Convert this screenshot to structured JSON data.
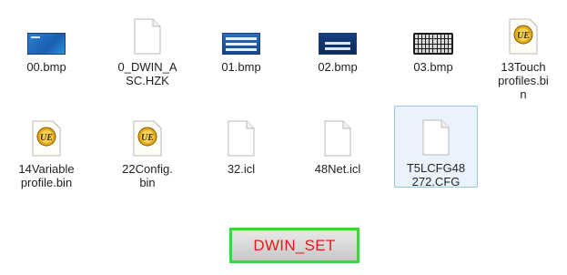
{
  "files": [
    {
      "name": "00.bmp",
      "lines": [
        "00.bmp"
      ],
      "type": "bmp-blue-login"
    },
    {
      "name": "0_DWIN_ASC.HZK",
      "lines": [
        "0_DWIN_A",
        "SC.HZK"
      ],
      "type": "blank-document"
    },
    {
      "name": "01.bmp",
      "lines": [
        "01.bmp"
      ],
      "type": "bmp-blue-form"
    },
    {
      "name": "02.bmp",
      "lines": [
        "02.bmp"
      ],
      "type": "bmp-dark-blue"
    },
    {
      "name": "03.bmp",
      "lines": [
        "03.bmp"
      ],
      "type": "bmp-keyboard"
    },
    {
      "name": "13Touch profiles.bin",
      "lines": [
        "13Touch",
        "profiles.bi",
        "n"
      ],
      "type": "ultraedit"
    },
    {
      "name": "14Variable profile.bin",
      "lines": [
        "14Variable",
        "profile.bin"
      ],
      "type": "ultraedit"
    },
    {
      "name": "22Config.bin",
      "lines": [
        "22Config.",
        "bin"
      ],
      "type": "ultraedit"
    },
    {
      "name": "32.icl",
      "lines": [
        "32.icl"
      ],
      "type": "blank-document"
    },
    {
      "name": "48Net.icl",
      "lines": [
        "48Net.icl"
      ],
      "type": "blank-document"
    },
    {
      "name": "T5LCFG48272.CFG",
      "lines": [
        "T5LCFG48",
        "272.CFG"
      ],
      "type": "blank-document",
      "selected": true
    }
  ],
  "dwin_button": {
    "label": "DWIN_SET"
  },
  "colors": {
    "selection_border": "#99c4e8",
    "selection_fill": "#eaf3fc",
    "button_border": "#3ed43e",
    "button_text": "#e11b1b"
  }
}
